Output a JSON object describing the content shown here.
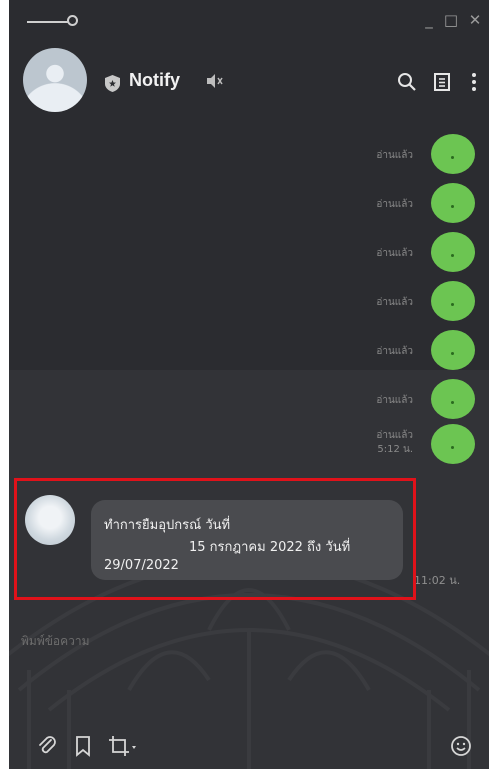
{
  "window": {
    "controls": {
      "minimize": "_",
      "maximize": "□",
      "close": "✕"
    }
  },
  "header": {
    "title": "Notify",
    "icons": [
      "shield-icon",
      "speaker-muted-icon",
      "search-icon",
      "notes-icon",
      "more-vertical-icon"
    ]
  },
  "messages": {
    "outgoing": [
      {
        "status": "อ่านแล้ว",
        "time": ""
      },
      {
        "status": "อ่านแล้ว",
        "time": ""
      },
      {
        "status": "อ่านแล้ว",
        "time": ""
      },
      {
        "status": "อ่านแล้ว",
        "time": ""
      },
      {
        "status": "อ่านแล้ว",
        "time": ""
      },
      {
        "status": "อ่านแล้ว",
        "time": ""
      },
      {
        "status": "อ่านแล้ว",
        "time": "5:12 น."
      }
    ],
    "incoming": {
      "line1": "ทำการยืมอุปกรณ์ วันที่",
      "line2": "15 กรกฎาคม 2022 ถึง วันที่",
      "line3": "29/07/2022",
      "time": "11:02 น."
    }
  },
  "composer": {
    "placeholder": "พิมพ์ข้อความ"
  },
  "toolbar": {
    "icons": [
      "attach-icon",
      "bookmark-icon",
      "crop-icon",
      "emoji-icon"
    ]
  },
  "colors": {
    "background": "#2b2c30",
    "outgoing_bubble": "#6cc552",
    "incoming_bubble": "#4a4b4f",
    "highlight": "#e0121a"
  }
}
